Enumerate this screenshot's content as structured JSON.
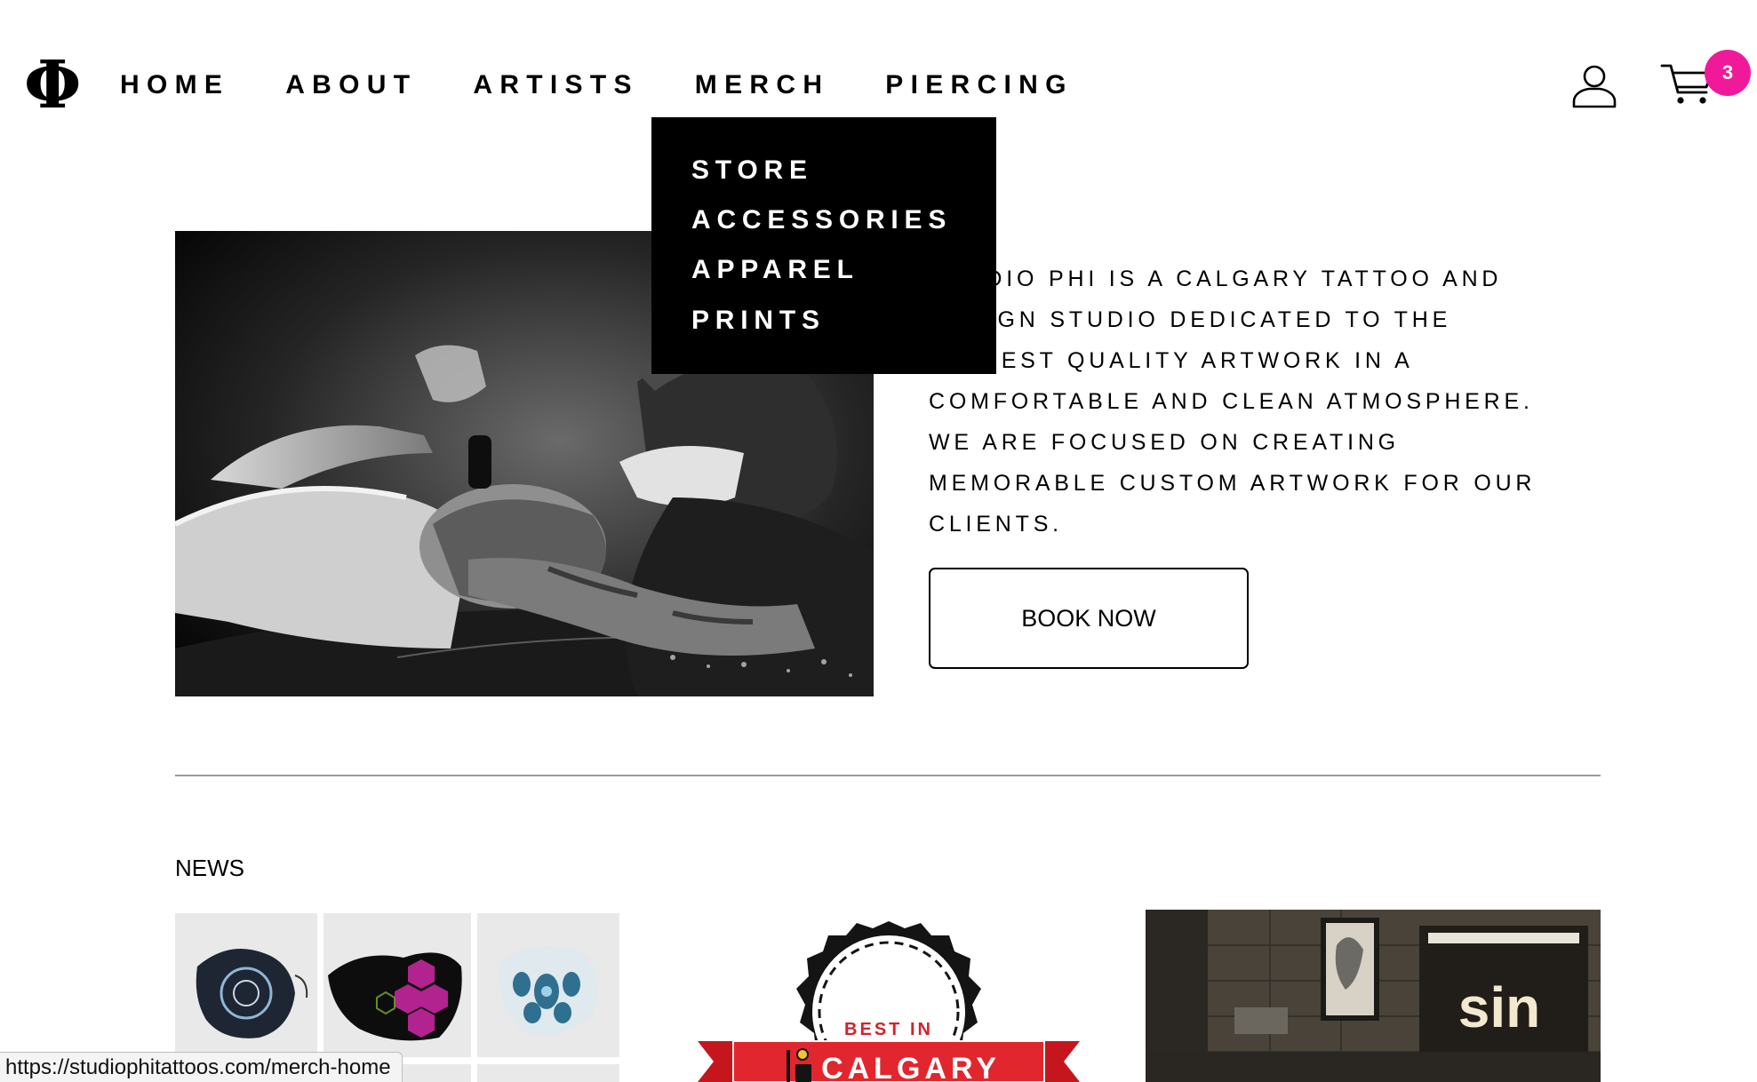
{
  "header": {
    "logo": "Φ",
    "nav": [
      {
        "label": "HOME"
      },
      {
        "label": "ABOUT"
      },
      {
        "label": "ARTISTS"
      },
      {
        "label": "MERCH"
      },
      {
        "label": "PIERCING"
      }
    ],
    "user_icon": "user-icon",
    "cart_icon": "cart-icon",
    "cart_count": "3",
    "badge_color": "#f0199a"
  },
  "dropdown": {
    "items": [
      {
        "label": "STORE"
      },
      {
        "label": "ACCESSORIES"
      },
      {
        "label": "APPAREL"
      },
      {
        "label": "PRINTS"
      }
    ]
  },
  "hero": {
    "about_text": "STUDIO PHI IS A CALGARY TATTOO AND\nDESIGN STUDIO DEDICATED TO THE\nHIGHEST QUALITY ARTWORK IN A\nCOMFORTABLE AND CLEAN ATMOSPHERE.\nWE ARE FOCUSED ON CREATING\nMEMORABLE CUSTOM ARTWORK FOR OUR\nCLIENTS.",
    "book_button": "BOOK NOW"
  },
  "news": {
    "label": "NEWS",
    "badge_top": "BEST IN",
    "badge_city": "CALGARY",
    "shop_sign": "sin"
  },
  "status_bar": {
    "url": "https://studiophitattoos.com/merch-home"
  }
}
